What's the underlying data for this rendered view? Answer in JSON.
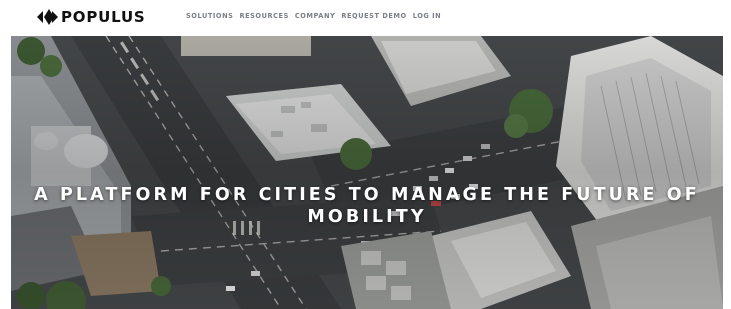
{
  "brand": {
    "name": "POPULUS",
    "logo_icon": "populus-diamond-arrows-icon"
  },
  "nav": {
    "items": [
      {
        "label": "SOLUTIONS"
      },
      {
        "label": "RESOURCES"
      },
      {
        "label": "COMPANY"
      },
      {
        "label": "REQUEST DEMO"
      },
      {
        "label": "LOG IN"
      }
    ]
  },
  "hero": {
    "title_line1": "A PLATFORM FOR CITIES TO MANAGE THE FUTURE OF",
    "title_line2": "MOBILITY",
    "image": "aerial-city-intersection-photo"
  },
  "colors": {
    "nav_text": "#7b7f86",
    "brand_text": "#111111",
    "hero_text": "#ffffff"
  }
}
